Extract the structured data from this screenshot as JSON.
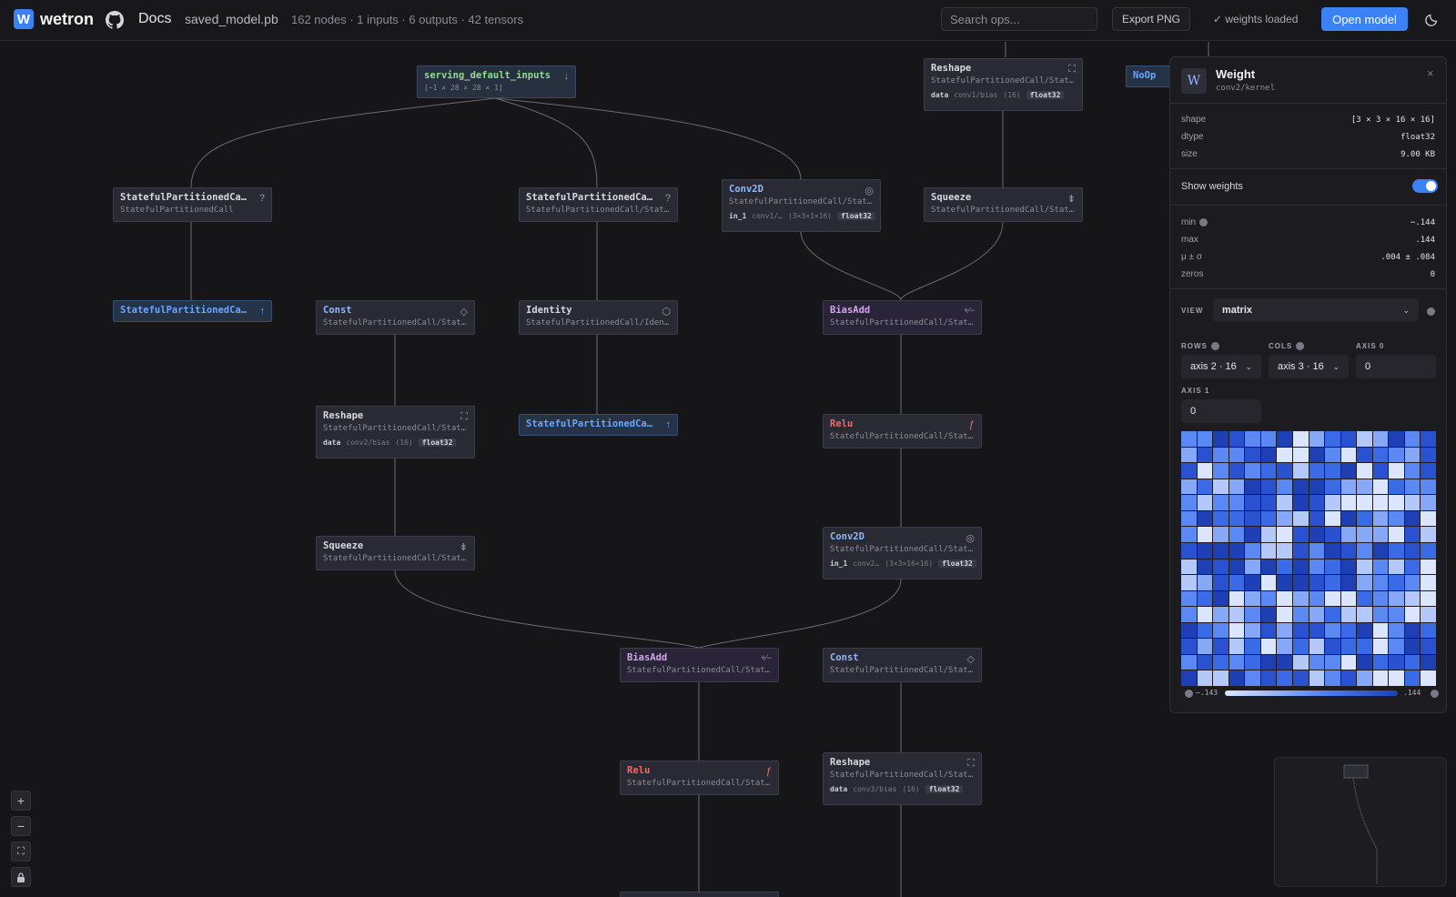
{
  "header": {
    "brand": "wetron",
    "docs": "Docs",
    "file_name": "saved_model.pb",
    "stats": "162 nodes · 1 inputs · 6 outputs · 42 tensors",
    "search_placeholder": "Search ops...",
    "export_label": "Export PNG",
    "weights_status": "✓ weights loaded",
    "open_label": "Open model"
  },
  "nodes": [
    {
      "id": "n-input",
      "title": "serving_default_inputs",
      "sub": "[−1 × 28 × 28 × 1]",
      "icon": "↓",
      "kind": "in"
    },
    {
      "id": "n-spc1",
      "title": "StatefulPartitionedCa…",
      "sub": "StatefulPartitionedCall",
      "icon": "?"
    },
    {
      "id": "n-spc2",
      "title": "StatefulPartitionedCa…",
      "sub": "StatefulPartitionedCall/State…",
      "icon": "?"
    },
    {
      "id": "n-conv1",
      "title": "Conv2D",
      "sub": "StatefulPartitionedCall/State…",
      "icon": "◎",
      "meta_key": "in_1",
      "meta_name": "conv1/…",
      "meta_shape": "(3×3×1×16)",
      "meta_dtype": "float32"
    },
    {
      "id": "n-reshape-top",
      "title": "Reshape",
      "sub": "StatefulPartitionedCall/State…",
      "icon": "⛶",
      "meta_key": "data",
      "meta_name": "conv1/bias",
      "meta_shape": "(16)",
      "meta_dtype": "float32"
    },
    {
      "id": "n-noop",
      "title": "NoOp"
    },
    {
      "id": "n-squeeze-top",
      "title": "Squeeze",
      "sub": "StatefulPartitionedCall/State…",
      "icon": "⇟"
    },
    {
      "id": "n-out1",
      "title": "StatefulPartitionedCa…",
      "icon": "↑",
      "kind": "out"
    },
    {
      "id": "n-const1",
      "title": "Const",
      "sub": "StatefulPartitionedCall/State…",
      "icon": "◇"
    },
    {
      "id": "n-identity",
      "title": "Identity",
      "sub": "StatefulPartitionedCall/Ident…",
      "icon": "⬡"
    },
    {
      "id": "n-biasadd1",
      "title": "BiasAdd",
      "sub": "StatefulPartitionedCall/State…",
      "icon": "+∕−"
    },
    {
      "id": "n-reshape2",
      "title": "Reshape",
      "sub": "StatefulPartitionedCall/State…",
      "icon": "⛶",
      "meta_key": "data",
      "meta_name": "conv2/bias",
      "meta_shape": "(16)",
      "meta_dtype": "float32"
    },
    {
      "id": "n-out2",
      "title": "StatefulPartitionedCa…",
      "icon": "↑",
      "kind": "out"
    },
    {
      "id": "n-relu1",
      "title": "Relu",
      "sub": "StatefulPartitionedCall/State…",
      "icon": "ƒ"
    },
    {
      "id": "n-conv2",
      "title": "Conv2D",
      "sub": "StatefulPartitionedCall/State…",
      "icon": "◎",
      "meta_key": "in_1",
      "meta_name": "conv2…",
      "meta_shape": "(3×3×16×16)",
      "meta_dtype": "float32"
    },
    {
      "id": "n-squeeze2",
      "title": "Squeeze",
      "sub": "StatefulPartitionedCall/State…",
      "icon": "⇟"
    },
    {
      "id": "n-biasadd2",
      "title": "BiasAdd",
      "sub": "StatefulPartitionedCall/State…",
      "icon": "+∕−"
    },
    {
      "id": "n-const2",
      "title": "Const",
      "sub": "StatefulPartitionedCall/State…",
      "icon": "◇"
    },
    {
      "id": "n-relu2",
      "title": "Relu",
      "sub": "StatefulPartitionedCall/State…",
      "icon": "ƒ"
    },
    {
      "id": "n-reshape3",
      "title": "Reshape",
      "sub": "StatefulPartitionedCall/State…",
      "icon": "⛶",
      "meta_key": "data",
      "meta_name": "conv3/bias",
      "meta_shape": "(16)",
      "meta_dtype": "float32"
    }
  ],
  "panel": {
    "badge": "W",
    "title": "Weight",
    "subtitle": "conv2/kernel",
    "close": "×",
    "shape_label": "shape",
    "shape_value": "[3 × 3 × 16 × 16]",
    "dtype_label": "dtype",
    "dtype_value": "float32",
    "size_label": "size",
    "size_value": "9.00 KB",
    "show_weights_label": "Show weights",
    "show_weights": true,
    "min_label": "min",
    "min_value": "−.144",
    "max_label": "max",
    "max_value": ".144",
    "mean_label": "μ ± σ",
    "mean_value": ".004 ± .084",
    "zeros_label": "zeros",
    "zeros_value": "0",
    "view_label": "VIEW",
    "view_value": "matrix",
    "rows_label": "ROWS",
    "rows_value": "axis 2 · 16",
    "cols_label": "COLS",
    "cols_value": "axis 3 · 16",
    "axis0_label": "AXIS 0",
    "axis0_value": "0",
    "axis1_label": "AXIS 1",
    "axis1_value": "0",
    "scale_min": "−.143",
    "scale_max": ".144"
  },
  "colors": {
    "accent": "#3b82f6",
    "background": "#161618",
    "node": "#2a2a34",
    "relu": "#f06a6a",
    "op_blue": "#8eb8ff",
    "input_green": "#8fdd8f"
  },
  "icons": {
    "zoom_in": "plus-icon",
    "zoom_out": "minus-icon",
    "fit": "fit-icon",
    "lock": "lock-icon"
  }
}
